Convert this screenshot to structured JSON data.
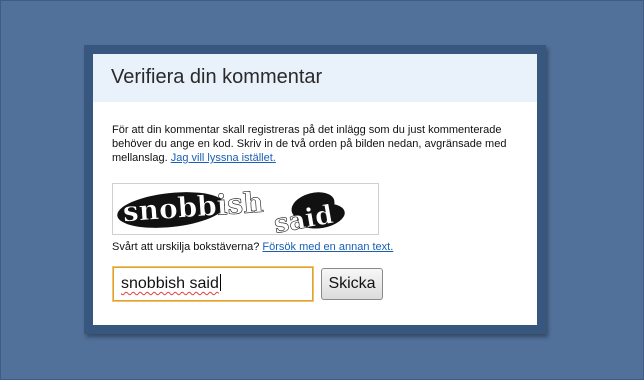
{
  "dialog": {
    "title": "Verifiera din kommentar",
    "instructions_text": "För att din kommentar skall registreras på det inlägg som du just kommenterade behöver du ange en kod. Skriv in de två orden på bilden nedan, avgränsade med mellanslag.",
    "listen_link": "Jag vill lyssna istället.",
    "captcha": {
      "word1": "snobbish",
      "word2": "said"
    },
    "hint_text": "Svårt att urskilja bokstäverna?",
    "other_text_link": "Försök med en annan text.",
    "answer_value": "snobbish said",
    "submit_label": "Skicka"
  }
}
